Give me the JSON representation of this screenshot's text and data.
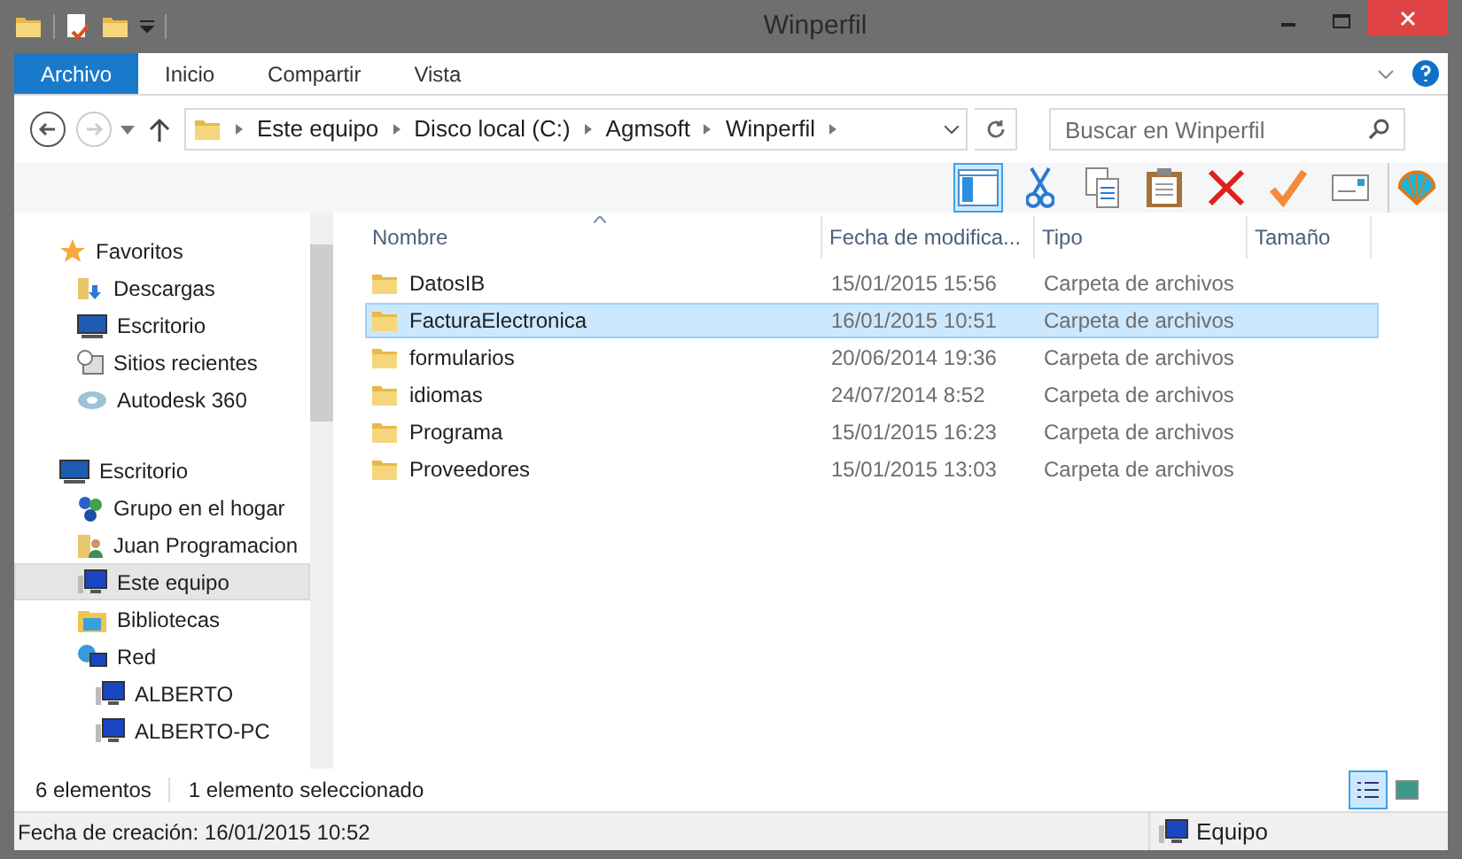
{
  "window": {
    "title": "Winperfil"
  },
  "ribbon_tabs": [
    {
      "label": "Archivo",
      "selected": true
    },
    {
      "label": "Inicio",
      "selected": false
    },
    {
      "label": "Compartir",
      "selected": false
    },
    {
      "label": "Vista",
      "selected": false
    }
  ],
  "address": {
    "path": [
      "Este equipo",
      "Disco local (C:)",
      "Agmsoft",
      "Winperfil"
    ]
  },
  "search": {
    "placeholder": "Buscar en Winperfil"
  },
  "toolbar": [
    {
      "kind": "pane",
      "selected": true
    },
    {
      "kind": "cut",
      "selected": false
    },
    {
      "kind": "copy",
      "selected": false
    },
    {
      "kind": "paste",
      "selected": false
    },
    {
      "kind": "delete",
      "selected": false
    },
    {
      "kind": "check",
      "selected": false
    },
    {
      "kind": "card",
      "selected": false
    },
    {
      "kind": "shell",
      "selected": false
    }
  ],
  "sidebar": {
    "items": [
      {
        "label": "Favoritos",
        "kind": "star",
        "selected": false,
        "children": [
          {
            "label": "Descargas",
            "kind": "download",
            "selected": false
          },
          {
            "label": "Escritorio",
            "kind": "monitor",
            "selected": false
          },
          {
            "label": "Sitios recientes",
            "kind": "recent",
            "selected": false
          },
          {
            "label": "Autodesk 360",
            "kind": "cloud",
            "selected": false
          }
        ]
      },
      {
        "label": "Escritorio",
        "kind": "monitor",
        "selected": false,
        "children": [
          {
            "label": "Grupo en el hogar",
            "kind": "group",
            "selected": false
          },
          {
            "label": "Juan Programacion",
            "kind": "user",
            "selected": false
          },
          {
            "label": "Este equipo",
            "kind": "pc",
            "selected": true
          },
          {
            "label": "Bibliotecas",
            "kind": "library",
            "selected": false
          },
          {
            "label": "Red",
            "kind": "network",
            "selected": false,
            "children": [
              {
                "label": "ALBERTO",
                "kind": "pc",
                "selected": false
              },
              {
                "label": "ALBERTO-PC",
                "kind": "pc",
                "selected": false
              }
            ]
          }
        ]
      }
    ]
  },
  "table": {
    "columns": [
      {
        "label": "Nombre",
        "sorted": true
      },
      {
        "label": "Fecha de modifica...",
        "sorted": false
      },
      {
        "label": "Tipo",
        "sorted": false
      },
      {
        "label": "Tamaño",
        "sorted": false
      }
    ],
    "rows": [
      {
        "name": "DatosIB",
        "date": "15/01/2015 15:56",
        "type": "Carpeta de archivos",
        "selected": false
      },
      {
        "name": "FacturaElectronica",
        "date": "16/01/2015 10:51",
        "type": "Carpeta de archivos",
        "selected": true
      },
      {
        "name": "formularios",
        "date": "20/06/2014 19:36",
        "type": "Carpeta de archivos",
        "selected": false
      },
      {
        "name": "idiomas",
        "date": "24/07/2014 8:52",
        "type": "Carpeta de archivos",
        "selected": false
      },
      {
        "name": "Programa",
        "date": "15/01/2015 16:23",
        "type": "Carpeta de archivos",
        "selected": false
      },
      {
        "name": "Proveedores",
        "date": "15/01/2015 13:03",
        "type": "Carpeta de archivos",
        "selected": false
      }
    ]
  },
  "status_bar": {
    "count": "6 elementos",
    "selection": "1 elemento seleccionado",
    "views": [
      {
        "kind": "details",
        "selected": true
      },
      {
        "kind": "thumbnails",
        "selected": false
      }
    ]
  },
  "details_bar": {
    "created": "Fecha de creación: 16/01/2015 10:52",
    "location": "Equipo"
  }
}
